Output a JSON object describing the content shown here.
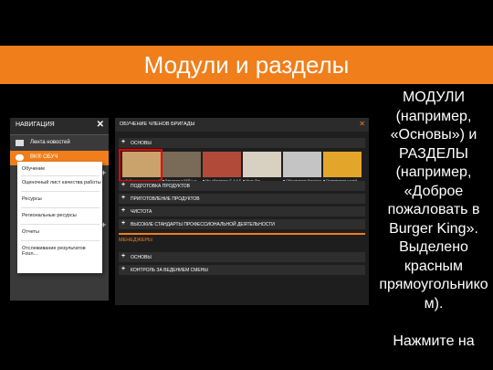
{
  "slide": {
    "title": "Модули и разделы",
    "side_text": "МОДУЛИ (например, «Основы») и РАЗДЕЛЫ (например, «Доброе пожаловать в Burger King». Выделено красным прямоугольнико м).\n\nНажмите на"
  },
  "nav": {
    "header": "НАВИГАЦИЯ",
    "close": "✕",
    "items": [
      {
        "label": "Лента новостей"
      },
      {
        "label": "BK® ОБУЧ"
      }
    ],
    "dropdown": [
      {
        "label": "Обучение"
      },
      {
        "label": "Оценочный лист качества работы"
      },
      {
        "label": "Ресурсы"
      },
      {
        "label": "Региональные ресурсы"
      },
      {
        "label": "Отчеты"
      },
      {
        "label": "Отслеживание результатов Foun..."
      }
    ],
    "plus": "+"
  },
  "main": {
    "header": "ОБУЧЕНИЕ ЧЛЕНОВ БРИГАДЫ",
    "header_mark": "✕",
    "module_osnovy": "ОСНОВЫ",
    "cards": [
      {
        "caption": "■ Доброе пожаловать в Burger King",
        "color": "#c9a36b"
      },
      {
        "caption": "■ Введение в ВК® Lux",
        "color": "#7a6a58"
      },
      {
        "caption": "■ Мы обучаемся (С.А.К.Е.)",
        "color": "#b24a3a"
      },
      {
        "caption": "■ Мыть Рук",
        "color": "#d8d0c0"
      },
      {
        "caption": "■ Обеспечение безопасн...",
        "color": "#c4c4c4"
      },
      {
        "caption": "■ Привлечение гостей",
        "color": "#e4a52b"
      }
    ],
    "modules": [
      {
        "label": "ПОДГОТОВКА ПРОДУКТОВ"
      },
      {
        "label": "ПРИГОТОВЛЕНИЕ ПРОДУКТОВ"
      },
      {
        "label": "ЧИСТОТА"
      },
      {
        "label": "ВЫСОКИЕ СТАНДАРТЫ ПРОФЕССИОНАЛЬНОЙ ДЕЯТЕЛЬНОСТИ"
      }
    ],
    "section2_label": "МЕНЕДЖЕРЫ",
    "modules2": [
      {
        "label": "ОСНОВЫ"
      },
      {
        "label": "КОНТРОЛЬ ЗА ВЕДЕНИЕМ СМЕНЫ"
      }
    ],
    "plus": "+"
  },
  "colors": {
    "accent": "#F07E1A",
    "highlight": "#ee0000",
    "panel": "#1e1e1e"
  }
}
